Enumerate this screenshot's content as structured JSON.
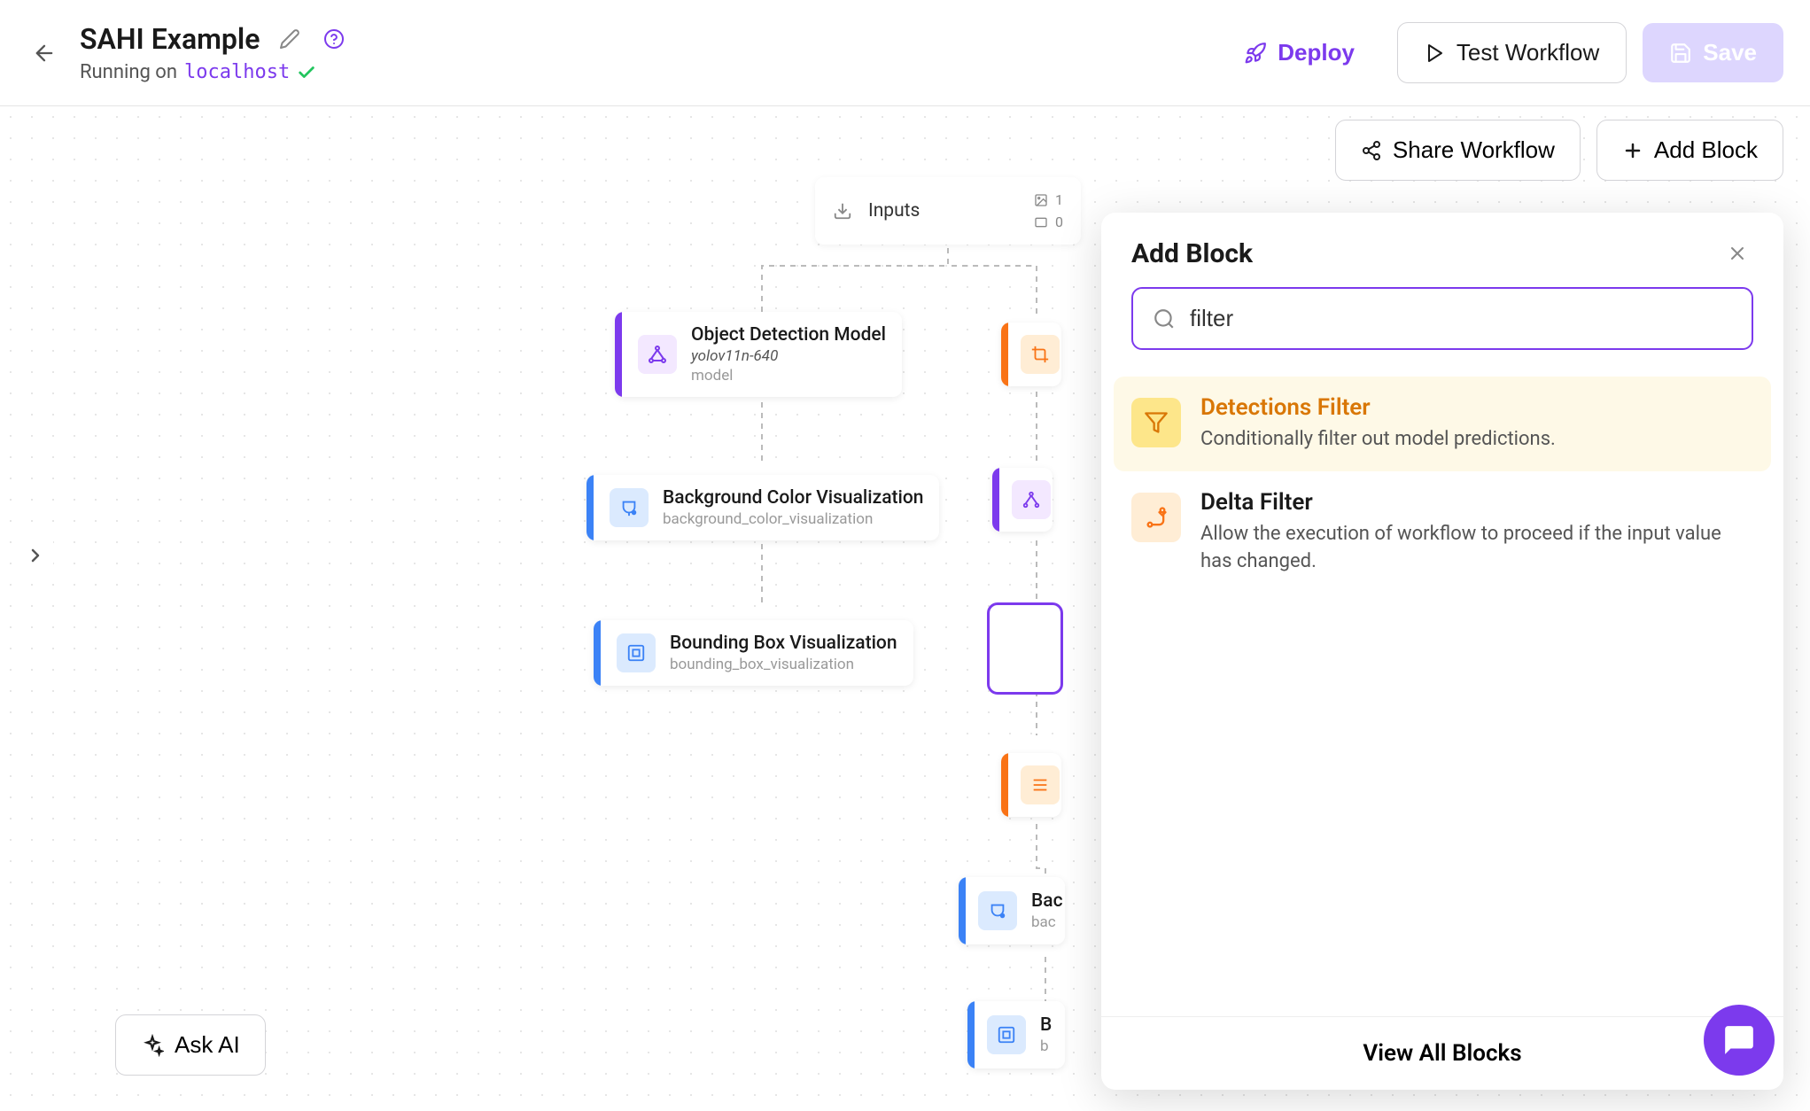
{
  "header": {
    "title": "SAHI Example",
    "running_prefix": "Running on ",
    "host": "localhost",
    "deploy_label": "Deploy",
    "test_label": "Test Workflow",
    "save_label": "Save"
  },
  "secondary": {
    "share_label": "Share Workflow",
    "add_block_label": "Add Block"
  },
  "ask_ai_label": "Ask AI",
  "inputs_node": {
    "label": "Inputs",
    "image_count": "1",
    "other_count": "0"
  },
  "nodes": {
    "obj_det": {
      "title": "Object Detection Model",
      "sub1": "yolov11n-640",
      "sub2": "model",
      "accent": "#7c3aed",
      "icon_bg": "#f3e8ff",
      "icon": "network"
    },
    "bg_color_vis": {
      "title": "Background Color Visualization",
      "sub1": "background_color_visualization",
      "accent": "#3b82f6",
      "icon_bg": "#dbeafe",
      "icon": "paint"
    },
    "bbox_vis": {
      "title": "Bounding Box Visualization",
      "sub1": "bounding_box_visualization",
      "accent": "#3b82f6",
      "icon_bg": "#dbeafe",
      "icon": "bbox"
    },
    "partial_crop": {
      "accent": "#f97316",
      "icon_bg": "#ffedd5",
      "icon": "crop"
    },
    "partial_network": {
      "accent": "#7c3aed",
      "icon_bg": "#f3e8ff",
      "icon": "network"
    },
    "partial_stitch": {
      "accent": "#f97316",
      "icon_bg": "#ffedd5",
      "icon": "stitch"
    },
    "partial_bg2": {
      "title_prefix": "Bac",
      "sub_prefix": "bac",
      "accent": "#3b82f6",
      "icon_bg": "#dbeafe",
      "icon": "paint"
    },
    "partial_bbox2": {
      "title_prefix": "B",
      "sub_prefix": "b",
      "accent": "#3b82f6",
      "icon_bg": "#dbeafe",
      "icon": "bbox"
    }
  },
  "panel": {
    "title": "Add Block",
    "search_value": "filter",
    "results": [
      {
        "title": "Detections Filter",
        "desc": "Conditionally filter out model predictions.",
        "highlighted": true,
        "icon_bg": "#fde68a",
        "icon_color": "#d97706",
        "title_color": "#d97706",
        "icon": "funnel"
      },
      {
        "title": "Delta Filter",
        "desc": "Allow the execution of workflow to proceed if the input value has changed.",
        "highlighted": false,
        "icon_bg": "#ffedd5",
        "icon_color": "#f97316",
        "title_color": "#1a1a1a",
        "icon": "route"
      }
    ],
    "footer_label": "View All Blocks"
  },
  "colors": {
    "primary": "#7c3aed"
  }
}
